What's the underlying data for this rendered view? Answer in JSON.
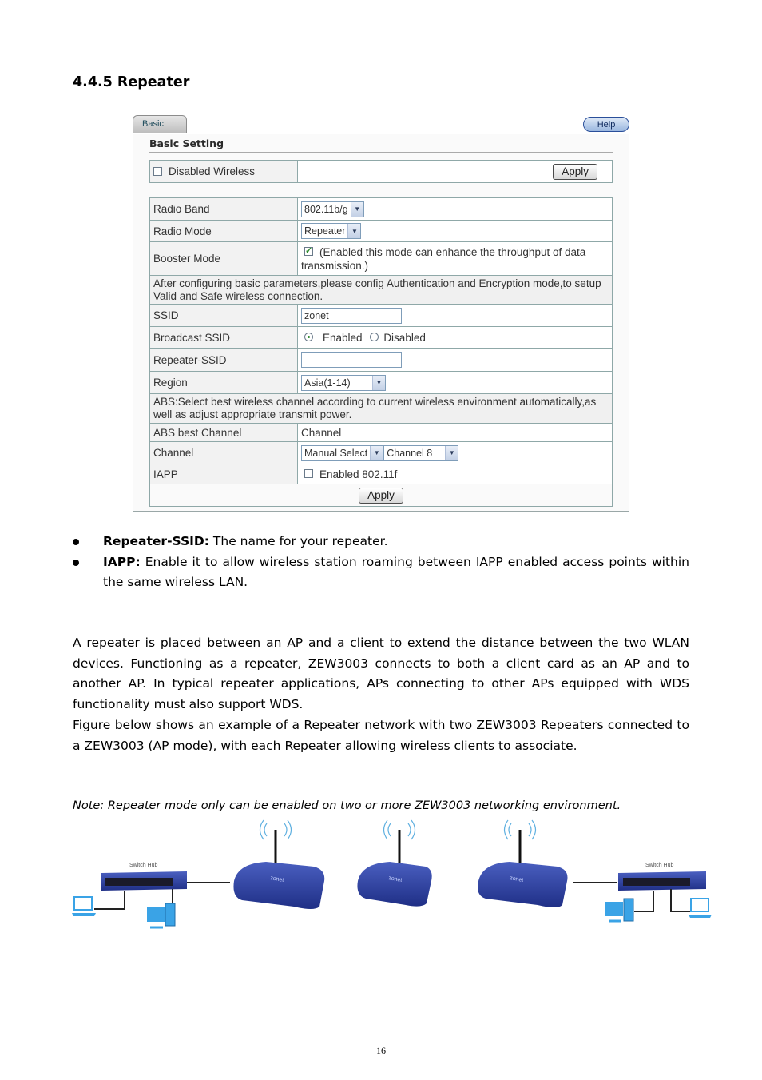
{
  "section": {
    "title": "4.4.5 Repeater"
  },
  "ui": {
    "tab_label": "Basic",
    "help_label": "Help",
    "heading": "Basic Setting",
    "disabled_wireless": {
      "label": "Disabled Wireless",
      "checked": false
    },
    "apply_top": "Apply",
    "rows": {
      "radio_band": {
        "label": "Radio Band",
        "value": "802.11b/g"
      },
      "radio_mode": {
        "label": "Radio Mode",
        "value": "Repeater"
      },
      "booster_mode": {
        "label": "Booster Mode",
        "checked": true,
        "text": "(Enabled this mode can enhance the throughput of data transmission.)"
      },
      "config_note": "After configuring basic parameters,please config Authentication and Encryption mode,to setup Valid and Safe wireless connection.",
      "ssid": {
        "label": "SSID",
        "value": "zonet"
      },
      "broadcast_ssid": {
        "label": "Broadcast SSID",
        "options": [
          "Enabled",
          "Disabled"
        ],
        "selected": "Enabled"
      },
      "repeater_ssid": {
        "label": "Repeater-SSID",
        "value": ""
      },
      "region": {
        "label": "Region",
        "value": "Asia(1-14)"
      },
      "abs_note": "ABS:Select best wireless channel according to current wireless environment automatically,as well as adjust appropriate transmit power.",
      "abs_best_channel": {
        "label": "ABS best Channel",
        "value": "Channel"
      },
      "channel": {
        "label": "Channel",
        "mode": "Manual Select",
        "value": "Channel 8"
      },
      "iapp": {
        "label": "IAPP",
        "checkbox_label": "Enabled 802.11f",
        "checked": false
      }
    },
    "apply_bottom": "Apply"
  },
  "bullets": [
    {
      "term": "Repeater-SSID:",
      "text": " The name for your repeater."
    },
    {
      "term": "IAPP:",
      "text": " Enable it to allow wireless station roaming between IAPP enabled access points within the same wireless LAN."
    }
  ],
  "paragraphs": [
    "A repeater is placed between an AP and a client to extend the distance between the two WLAN devices. Functioning as a repeater, ZEW3003 connects to both a client card as an AP and to another AP. In typical repeater applications, APs connecting to other APs equipped with WDS functionality must also support WDS.",
    "Figure below shows an example of a Repeater network with two ZEW3003 Repeaters connected to a ZEW3003 (AP mode), with each Repeater allowing wireless clients to associate."
  ],
  "note": "Note: Repeater mode only can be enabled on two or more ZEW3003 networking environment.",
  "diagram": {
    "left_hub_label": "Switch Hub",
    "right_hub_label": "Switch Hub",
    "router_brand": "zonet",
    "colors": {
      "device_blue": "#2c3f9a",
      "client_blue": "#3aa3e6",
      "signal": "#5fb0e0"
    }
  },
  "page_number": "16"
}
